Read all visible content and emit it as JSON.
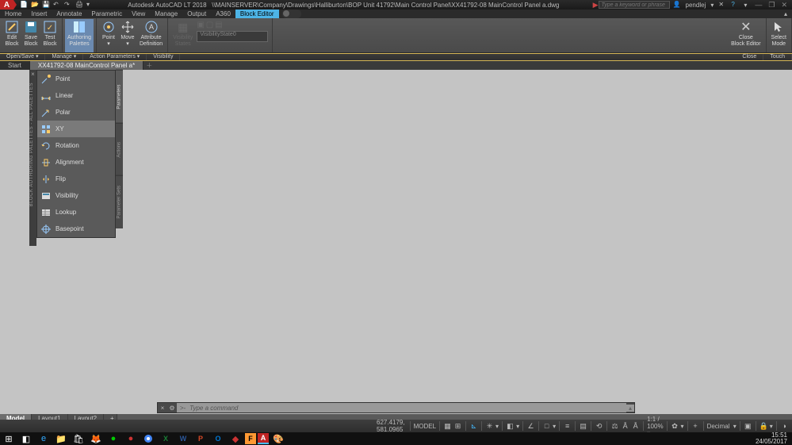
{
  "app": {
    "logo_letter": "A",
    "product": "Autodesk AutoCAD LT 2018",
    "filepath": "\\\\MAINSERVER\\Company\\Drawings\\Halliburton\\BOP Unit 41792\\Main Control Panel\\XX41792-08 MainControl Panel a.dwg",
    "search_placeholder": "Type a keyword or phrase",
    "user": "pendlej"
  },
  "menus": [
    "Home",
    "Insert",
    "Annotate",
    "Parametric",
    "View",
    "Manage",
    "Output",
    "A360",
    "Block Editor"
  ],
  "ribbon": {
    "edit_block": "Edit\nBlock",
    "save_block": "Save\nBlock",
    "test_block": "Test\nBlock",
    "authoring": "Authoring\nPalettes",
    "point": "Point",
    "move": "Move",
    "attribute_def": "Attribute\nDefinition",
    "vis_states": "Visibility\nStates",
    "vis_combo": "VisibilityState0",
    "close_editor": "Close\nBlock Editor",
    "select_mode": "Select\nMode"
  },
  "panels": {
    "open_save": "Open/Save ▾",
    "manage": "Manage ▾",
    "action_params": "Action Parameters ▾",
    "visibility": "Visibility",
    "close": "Close",
    "touch": "Touch"
  },
  "doctabs": {
    "start": "Start",
    "file": "XX41792-08 MainControl Panel a*"
  },
  "palette": {
    "title": "BLOCK AUTHORING PALETTES - ALL PALETTES",
    "items": [
      "Point",
      "Linear",
      "Polar",
      "XY",
      "Rotation",
      "Alignment",
      "Flip",
      "Visibility",
      "Lookup",
      "Basepoint"
    ],
    "tabs": [
      "Parameters",
      "Actions",
      "Parameter Sets"
    ]
  },
  "cmd": {
    "prompt": ">-",
    "placeholder": "Type a command"
  },
  "layouts": [
    "Model",
    "Layout1",
    "Layout2"
  ],
  "status": {
    "coords": "627.4179, 581.0965",
    "space": "MODEL",
    "scale": "1:1 / 100% ▾",
    "units": "Decimal"
  },
  "clock": {
    "time": "15:51",
    "date": "24/05/2017"
  },
  "taskbar_apps": [
    "⊞",
    "◧",
    "e",
    "📁",
    "🛒",
    "🦊",
    "🟢",
    "⬤",
    "🔵",
    "X",
    "W",
    "P",
    "O",
    "◆",
    "F",
    "A",
    "🎨"
  ]
}
